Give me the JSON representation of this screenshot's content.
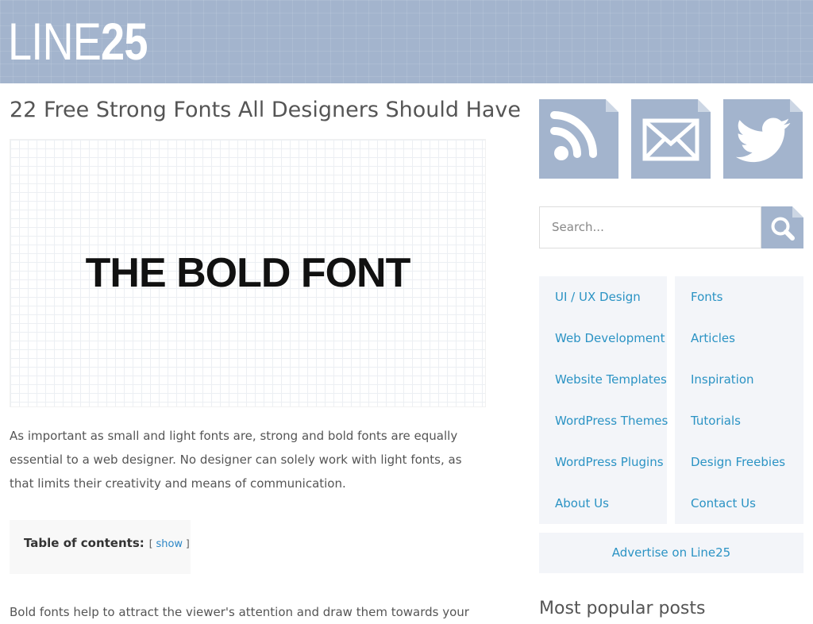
{
  "site": {
    "logo_light": "LINE",
    "logo_bold": "25",
    "colors": {
      "brand": "#a3b4cd",
      "link": "#2b93c4",
      "panel": "#f3f5f9"
    }
  },
  "post": {
    "title": "22 Free Strong Fonts All Designers Should Have",
    "featured_image_text": "THE BOLD FONT",
    "intro": "As important as small and light fonts are, strong and bold fonts are equally essential to a web designer. No designer can solely work with light fonts, as that limits their creativity and means of communication.",
    "toc": {
      "title": "Table of contents:",
      "bracket_open": "[",
      "show_label": "show",
      "bracket_close": "]"
    },
    "next_paragraph_start": "Bold fonts help to attract the viewer's attention and draw them towards your"
  },
  "sidebar": {
    "social": [
      {
        "name": "rss",
        "icon": "rss-icon"
      },
      {
        "name": "email",
        "icon": "mail-icon"
      },
      {
        "name": "twitter",
        "icon": "twitter-bird-icon"
      }
    ],
    "search": {
      "placeholder": "Search...",
      "icon": "search-icon"
    },
    "categories_left": [
      "UI / UX Design",
      "Web Development",
      "Website Templates",
      "WordPress Themes",
      "WordPress Plugins",
      "About Us"
    ],
    "categories_right": [
      "Fonts",
      "Articles",
      "Inspiration",
      "Tutorials",
      "Design Freebies",
      "Contact Us"
    ],
    "advertise": "Advertise on Line25",
    "popular_heading": "Most popular posts"
  }
}
